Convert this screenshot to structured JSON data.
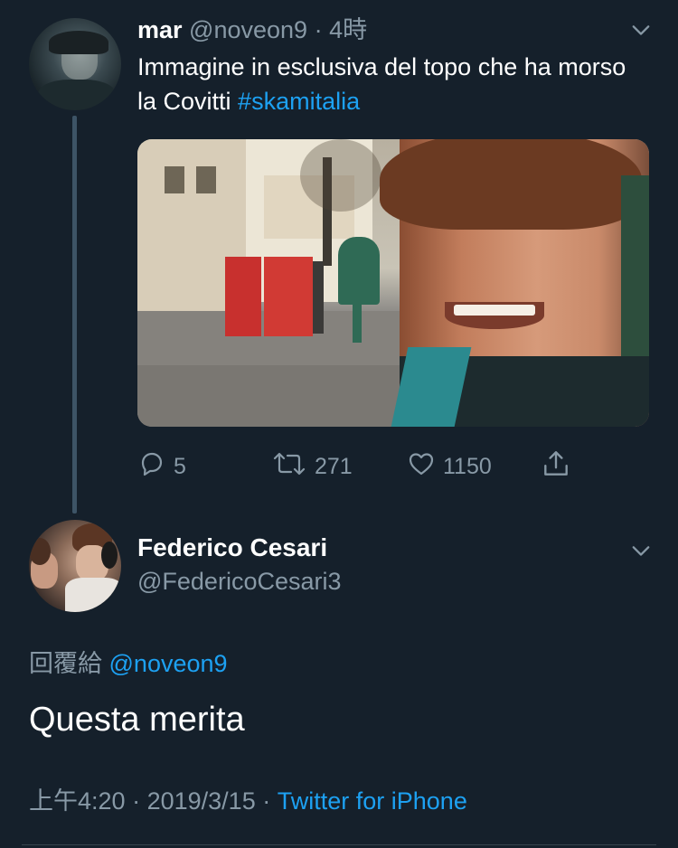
{
  "tweet1": {
    "author_name": "mar",
    "handle": "@noveon9",
    "separator": "·",
    "time": "4時",
    "text": "Immagine in esclusiva del topo che ha morso la Covitti",
    "hashtag": "#skamitalia",
    "actions": {
      "replies": "5",
      "retweets": "271",
      "likes": "1150"
    }
  },
  "tweet2": {
    "author_name": "Federico Cesari",
    "handle": "@FedericoCesari3",
    "reply_prefix": "回覆給",
    "reply_to": "@noveon9",
    "text": "Questa merita",
    "time": "上午4:20",
    "separator1": "·",
    "date": "2019/3/15",
    "separator2": "·",
    "source": "Twitter for iPhone"
  },
  "colors": {
    "background": "#15202b",
    "text": "#ffffff",
    "muted": "#8899a6",
    "link": "#1da1f2",
    "thread_line": "#3d5466"
  },
  "icons": [
    "chevron-down-icon",
    "reply-icon",
    "retweet-icon",
    "like-icon",
    "share-icon"
  ]
}
